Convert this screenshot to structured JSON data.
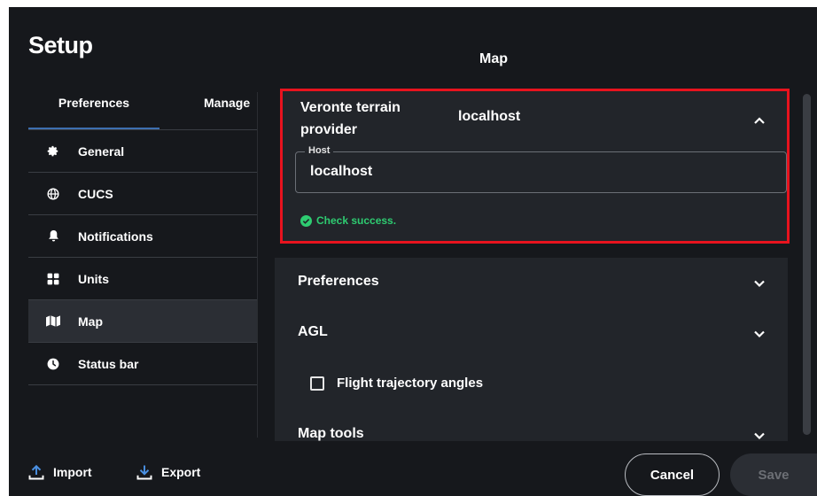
{
  "dialog": {
    "title": "Setup",
    "section_title": "Map"
  },
  "tabs": {
    "preferences": "Preferences",
    "manage": "Manage"
  },
  "nav": [
    {
      "label": "General",
      "icon": "gear-icon"
    },
    {
      "label": "CUCS",
      "icon": "globe-icon"
    },
    {
      "label": "Notifications",
      "icon": "bell-icon"
    },
    {
      "label": "Units",
      "icon": "grid-icon"
    },
    {
      "label": "Map",
      "icon": "map-icon",
      "selected": true
    },
    {
      "label": "Status bar",
      "icon": "clock-icon"
    }
  ],
  "terrain": {
    "label": "Veronte terrain provider",
    "value": "localhost",
    "host_legend": "Host",
    "host_value": "localhost",
    "status": "Check success."
  },
  "sections": {
    "preferences": "Preferences",
    "agl": "AGL",
    "flight_trajectory": "Flight trajectory angles",
    "map_tools": "Map tools"
  },
  "footer": {
    "import": "Import",
    "export": "Export",
    "cancel": "Cancel",
    "save": "Save"
  },
  "colors": {
    "highlight": "#e8131e",
    "success": "#2ecc71",
    "tab_underline": "#3d6fb0"
  }
}
